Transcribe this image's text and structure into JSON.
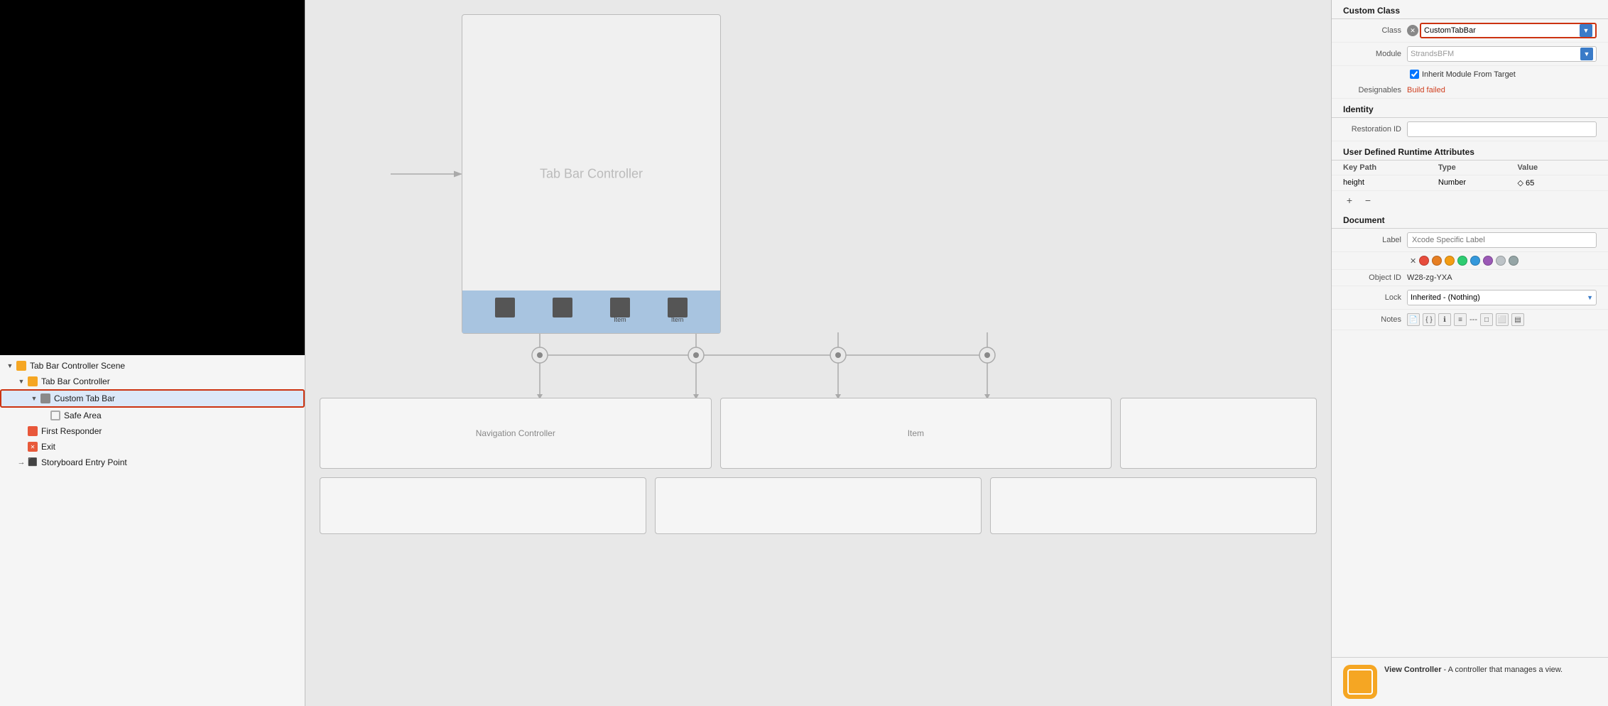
{
  "sceneTree": {
    "items": [
      {
        "id": "scene-root",
        "label": "Tab Bar Controller Scene",
        "indent": 0,
        "arrow": "▼",
        "iconType": "scene",
        "selected": false
      },
      {
        "id": "tabbar-ctrl",
        "label": "Tab Bar Controller",
        "indent": 1,
        "arrow": "▼",
        "iconType": "tabbar",
        "selected": false
      },
      {
        "id": "custom-tabbar",
        "label": "Custom Tab Bar",
        "indent": 2,
        "arrow": "▼",
        "iconType": "custom",
        "selected": true
      },
      {
        "id": "safe-area",
        "label": "Safe Area",
        "indent": 3,
        "arrow": "",
        "iconType": "safe",
        "selected": false
      },
      {
        "id": "first-responder",
        "label": "First Responder",
        "indent": 1,
        "arrow": "",
        "iconType": "first",
        "selected": false
      },
      {
        "id": "exit",
        "label": "Exit",
        "indent": 1,
        "arrow": "",
        "iconType": "exit",
        "selected": false
      },
      {
        "id": "storyboard-entry",
        "label": "Storyboard Entry Point",
        "indent": 1,
        "arrow": "→",
        "iconType": "entry",
        "selected": false
      }
    ]
  },
  "canvas": {
    "deviceTitle": "Tab Bar Controller",
    "tabItems": [
      "",
      "",
      "Item",
      "Item"
    ],
    "controllers": [
      {
        "label": "Navigation Controller"
      },
      {
        "label": "Item"
      },
      {
        "label": ""
      }
    ]
  },
  "rightPanel": {
    "sections": {
      "customClass": {
        "title": "Custom Class",
        "classLabel": "Class",
        "classValue": "CustomTabBar",
        "moduleLabel": "Module",
        "moduleValue": "StrandsBFM",
        "inheritLabel": "Inherit Module From Target",
        "designablesLabel": "Designables",
        "designablesValue": "Build failed"
      },
      "identity": {
        "title": "Identity",
        "restorationIdLabel": "Restoration ID",
        "restorationIdValue": ""
      },
      "userDefinedRuntime": {
        "title": "User Defined Runtime Attributes",
        "columns": [
          "Key Path",
          "Type",
          "Value"
        ],
        "rows": [
          {
            "keyPath": "height",
            "type": "Number",
            "value": "◇ 65"
          }
        ]
      },
      "document": {
        "title": "Document",
        "labelLabel": "Label",
        "labelPlaceholder": "Xcode Specific Label",
        "objectIdLabel": "Object ID",
        "objectIdValue": "W28-zg-YXA",
        "lockLabel": "Lock",
        "lockValue": "Inherited - (Nothing)",
        "notesLabel": "Notes",
        "colors": [
          "#e74c3c",
          "#e67e22",
          "#f1c40f",
          "#2ecc71",
          "#3498db",
          "#9b59b6",
          "#bdc3c7",
          "#95a5a6"
        ]
      }
    },
    "bottomInfo": {
      "iconType": "vc",
      "title": "View Controller",
      "description": "A controller that manages a view."
    }
  }
}
